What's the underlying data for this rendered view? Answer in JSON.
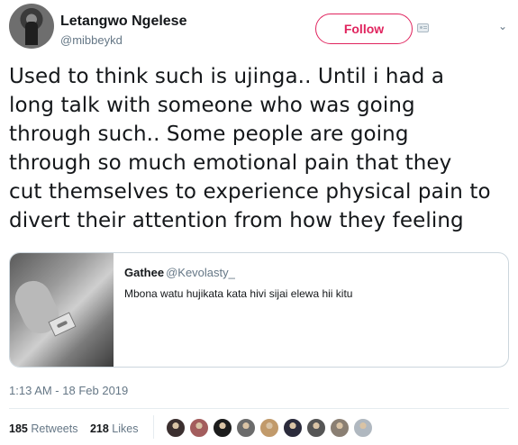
{
  "author": {
    "name": "Letangwo Ngelese",
    "handle": "@mibbeykd"
  },
  "follow_label": "Follow",
  "icons": {
    "avatar": "user-avatar",
    "follow_extra": "follow-card-icon",
    "menu": "chevron-down-icon"
  },
  "tweet_lines": [
    "Used to think such is ujinga.. Until i had a",
    "long talk with someone who was going",
    "through such.. Some people are going",
    "through so much emotional pain that they",
    "cut themselves to experience physical pain to",
    "divert their attention from how they feeling"
  ],
  "quote": {
    "name": "Gathee",
    "handle": "@Kevolasty_",
    "text": "Mbona watu hujikata kata hivi sijai elewa hii kitu"
  },
  "timestamp": "1:13 AM - 18 Feb 2019",
  "stats": {
    "retweets_count": "185",
    "retweets_label": "Retweets",
    "likes_count": "218",
    "likes_label": "Likes"
  },
  "liker_colors": [
    "#3b2f2f",
    "#a35d5d",
    "#1c1c1c",
    "#6b6b6b",
    "#c19a6b",
    "#2b2b3b",
    "#555555",
    "#8a7f73",
    "#b0b8c0"
  ],
  "colors": {
    "accent": "#e0245e",
    "text": "#14171a",
    "secondary": "#657786",
    "border": "#ccd6dd"
  }
}
